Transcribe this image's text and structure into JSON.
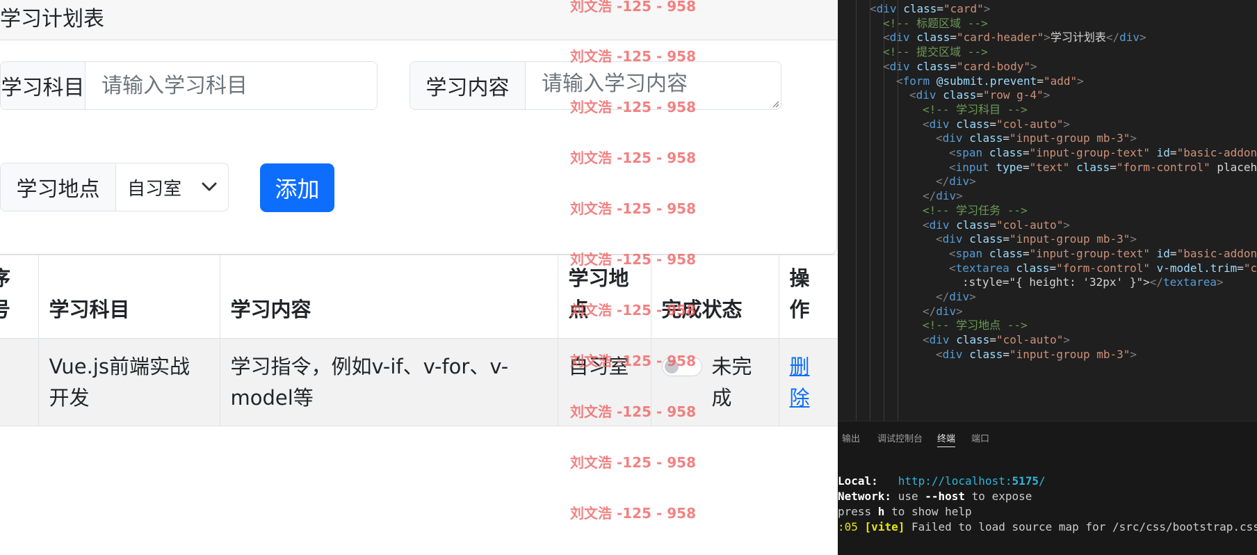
{
  "card": {
    "title": "学习计划表",
    "subject_label": "学习科目",
    "subject_placeholder": "请输入学习科目",
    "content_label": "学习内容",
    "content_placeholder": "请输入学习内容",
    "place_label": "学习地点",
    "place_selected": "自习室",
    "add_label": "添加"
  },
  "table": {
    "headers": [
      "序号",
      "学习科目",
      "学习内容",
      "学习地点",
      "完成状态",
      "操作"
    ],
    "rows": [
      {
        "index": "",
        "subject": "Vue.js前端实战开发",
        "content": "学习指令，例如v-if、v-for、v-model等",
        "place": "自习室",
        "status": "未完成",
        "status_checked": false,
        "action": "删除"
      }
    ]
  },
  "watermark": "刘文浩 -125 - 958",
  "editor": {
    "lines": [
      "<div class=\"card\">",
      "<!-- 标题区域 -->",
      "<div class=\"card-header\">学习计划表</div>",
      "<!-- 提交区域 -->",
      "<div class=\"card-body\">",
      "<form @submit.prevent=\"add\">",
      "<div class=\"row g-4\">",
      "<!-- 学习科目 -->",
      "<div class=\"col-auto\">",
      "<div class=\"input-group mb-3\">",
      "<span class=\"input-group-text\" id=\"basic-addon",
      "<input type=\"text\" class=\"form-control\" placeh",
      "</div>",
      "</div>",
      "<!-- 学习任务 -->",
      "<div class=\"col-auto\">",
      "<div class=\"input-group mb-3\">",
      "<span class=\"input-group-text\" id=\"basic-addon",
      "<textarea class=\"form-control\" v-model.trim=\"c",
      ":style=\"{ height: '32px' }\"></textarea>",
      "</div>",
      "</div>",
      "<!-- 学习地点 -->",
      "<div class=\"col-auto\">",
      "<div class=\"input-group mb-3\">"
    ]
  },
  "panel": {
    "tabs": [
      "输出",
      "调试控制台",
      "终端",
      "端口"
    ],
    "active_tab": "终端",
    "terminal": {
      "local_label": "Local:",
      "local_url_prefix": "http://localhost:",
      "local_port": "5175",
      "local_url_suffix": "/",
      "network_label": "Network:",
      "network_pre": " use ",
      "network_flag": "--host",
      "network_post": " to expose",
      "help_pre": "press ",
      "help_key": "h",
      "help_post": " to show help",
      "error_time": ":05",
      "error_tag": "[vite]",
      "error_text": " Failed to load source map for /src/css/bootstrap.css?dire"
    }
  }
}
